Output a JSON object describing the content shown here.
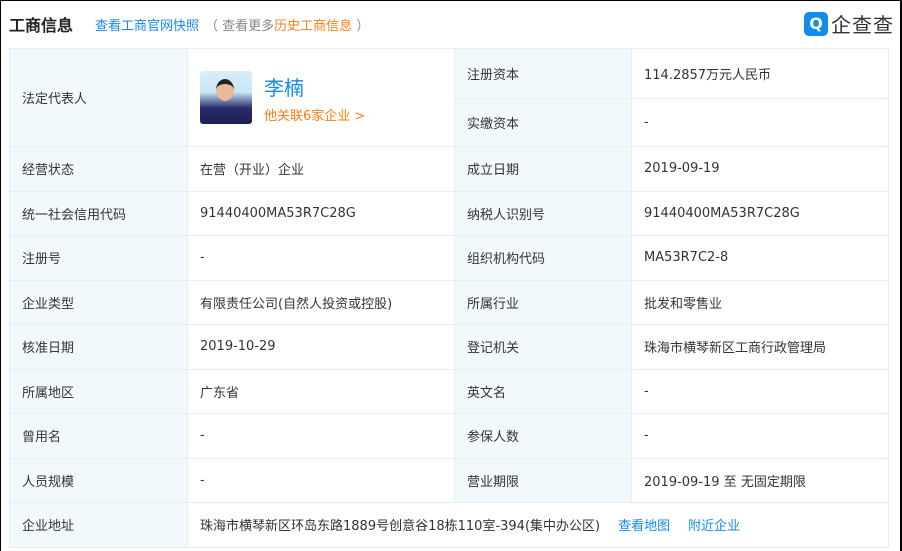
{
  "header": {
    "title": "工商信息",
    "snapshot_link": "查看工商官网快照",
    "paren_open": "（ 查看更多",
    "history_link": "历史工商信息",
    "paren_close": " ）"
  },
  "logo": {
    "icon": "qichacha-logo-icon",
    "text": "企查查"
  },
  "legal_rep": {
    "label": "法定代表人",
    "name": "李楠",
    "related": "他关联6家企业 >"
  },
  "registered_capital": {
    "label": "注册资本",
    "value": "114.2857万元人民币"
  },
  "paid_capital": {
    "label": "实缴资本",
    "value": "-"
  },
  "rows": [
    {
      "l1": "经营状态",
      "v1": "在营（开业）企业",
      "l2": "成立日期",
      "v2": "2019-09-19"
    },
    {
      "l1": "统一社会信用代码",
      "v1": "91440400MA53R7C28G",
      "l2": "纳税人识别号",
      "v2": "91440400MA53R7C28G"
    },
    {
      "l1": "注册号",
      "v1": "-",
      "l2": "组织机构代码",
      "v2": "MA53R7C2-8"
    },
    {
      "l1": "企业类型",
      "v1": "有限责任公司(自然人投资或控股)",
      "l2": "所属行业",
      "v2": "批发和零售业"
    },
    {
      "l1": "核准日期",
      "v1": "2019-10-29",
      "l2": "登记机关",
      "v2": "珠海市横琴新区工商行政管理局"
    },
    {
      "l1": "所属地区",
      "v1": "广东省",
      "l2": "英文名",
      "v2": "-"
    },
    {
      "l1": "曾用名",
      "v1": "-",
      "l2": "参保人数",
      "v2": "-"
    },
    {
      "l1": "人员规模",
      "v1": "-",
      "l2": "营业期限",
      "v2": "2019-09-19 至 无固定期限"
    }
  ],
  "address": {
    "label": "企业地址",
    "value": "珠海市横琴新区环岛东路1889号创意谷18栋110室-394(集中办公区)",
    "map_link": "查看地图",
    "nearby_link": "附近企业"
  }
}
